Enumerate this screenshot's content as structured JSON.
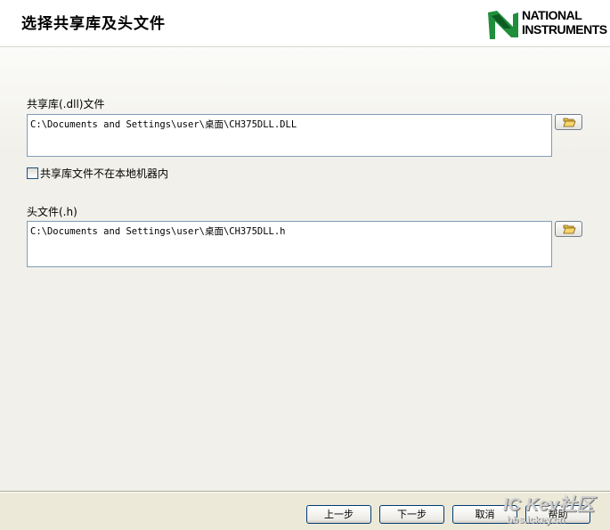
{
  "header": {
    "title": "选择共享库及头文件",
    "logo_line1": "NATIONAL",
    "logo_line2": "INSTRUMENTS"
  },
  "shared_library": {
    "label": "共享库(.dll)文件",
    "path": "C:\\Documents and Settings\\user\\桌面\\CH375DLL.DLL",
    "browse_icon": "folder-open-icon"
  },
  "remote_option": {
    "label": "共享库文件不在本地机器内",
    "checked": false
  },
  "header_file": {
    "label": "头文件(.h)",
    "path": "C:\\Documents and Settings\\user\\桌面\\CH375DLL.h",
    "browse_icon": "folder-open-icon"
  },
  "footer": {
    "back_label": "上一步",
    "next_label": "下一步",
    "cancel_label": "取消",
    "help_label": "帮助"
  },
  "watermark": {
    "main": "IC Kev社区",
    "sub": "bbs.ickey.cn"
  },
  "colors": {
    "logo_green": "#1f8f3c",
    "logo_black": "#000000",
    "field_border": "#7f9db9",
    "button_border": "#003c74"
  }
}
